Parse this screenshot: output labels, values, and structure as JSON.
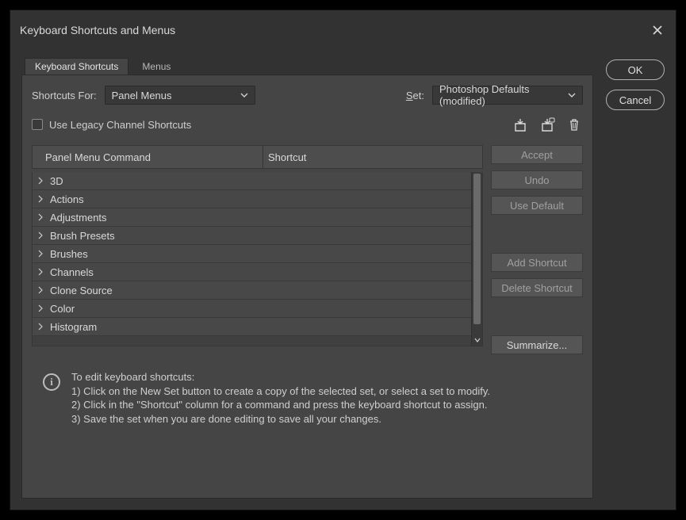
{
  "dialog": {
    "title": "Keyboard Shortcuts and Menus"
  },
  "tabs": {
    "shortcuts": "Keyboard Shortcuts",
    "menus": "Menus"
  },
  "row1": {
    "shortcuts_for_label": "Shortcuts For:",
    "shortcuts_for_value": "Panel Menus",
    "set_label": "Set:",
    "set_label_underlined": "S",
    "set_value": "Photoshop Defaults (modified)"
  },
  "row2": {
    "legacy_label": "Use Legacy Channel Shortcuts"
  },
  "table": {
    "header_command": "Panel Menu Command",
    "header_shortcut": "Shortcut",
    "rows": [
      "3D",
      "Actions",
      "Adjustments",
      "Brush Presets",
      "Brushes",
      "Channels",
      "Clone Source",
      "Color",
      "Histogram"
    ]
  },
  "buttons": {
    "accept": "Accept",
    "undo": "Undo",
    "use_default": "Use Default",
    "add": "Add Shortcut",
    "delete": "Delete Shortcut",
    "summarize": "Summarize..."
  },
  "side": {
    "ok": "OK",
    "cancel": "Cancel"
  },
  "help": {
    "heading": "To edit keyboard shortcuts:",
    "l1": "1) Click on the New Set button to create a copy of the selected set, or select a set to modify.",
    "l2": "2) Click in the \"Shortcut\" column for a command and press the keyboard shortcut to assign.",
    "l3": "3) Save the set when you are done editing to save all your changes."
  }
}
